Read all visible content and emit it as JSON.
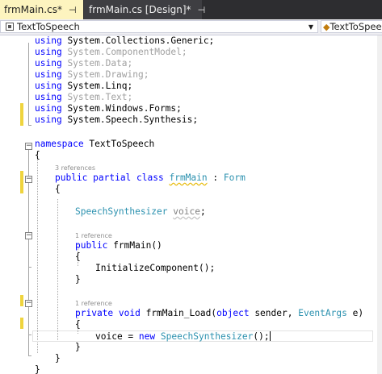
{
  "tabs": [
    {
      "label": "frmMain.cs*",
      "pin": "⊣",
      "close": "×"
    },
    {
      "label": "frmMain.cs [Design]*",
      "pin": "⊣",
      "close": "×"
    }
  ],
  "navbar": {
    "class_selector": "TextToSpeech",
    "member_selector": "TextToSpeech"
  },
  "code": {
    "using": [
      {
        "kw": "using",
        "ns": "System.Collections.Generic;",
        "used": true
      },
      {
        "kw": "using",
        "ns": "System.ComponentModel;",
        "used": false
      },
      {
        "kw": "using",
        "ns": "System.Data;",
        "used": false
      },
      {
        "kw": "using",
        "ns": "System.Drawing;",
        "used": false
      },
      {
        "kw": "using",
        "ns": "System.Linq;",
        "used": true
      },
      {
        "kw": "using",
        "ns": "System.Text;",
        "used": false
      },
      {
        "kw": "using",
        "ns": "System.Windows.Forms;",
        "used": true
      },
      {
        "kw": "using",
        "ns": "System.Speech.Synthesis;",
        "used": true
      }
    ],
    "ns_kw": "namespace",
    "ns_name": "TextToSpeech",
    "brace_open": "{",
    "brace_close": "}",
    "class_refs": "3 references",
    "class_mods": "public partial class",
    "class_name": "frmMain",
    "class_colon": ":",
    "class_base": "Form",
    "field_type": "SpeechSynthesizer",
    "field_name": "voice",
    "semicolon": ";",
    "ctor_refs": "1 reference",
    "ctor_kw": "public",
    "ctor_sig": "frmMain()",
    "ctor_body": "InitializeComponent();",
    "load_refs": "1 reference",
    "load_kw": "private void",
    "load_name": "frmMain_Load(",
    "load_obj": "object",
    "load_sender": "sender,",
    "load_evt": "EventArgs",
    "load_e": "e)",
    "assign_lhs": "voice =",
    "assign_new": "new",
    "assign_type": "SpeechSynthesizer",
    "assign_end": "();"
  }
}
